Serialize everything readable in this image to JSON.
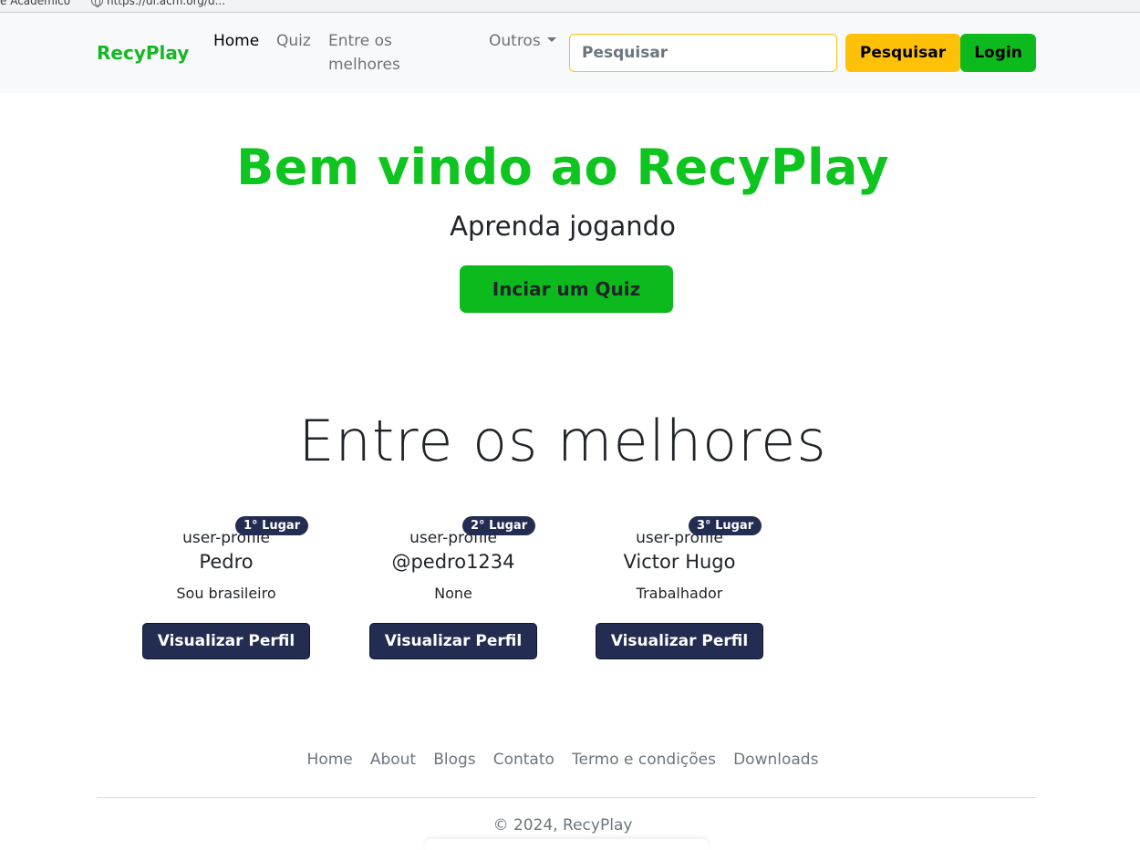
{
  "bookmarks": {
    "item1": "e Acadêmico",
    "item2": "https://dl.acm.org/d..."
  },
  "navbar": {
    "brand": "RecyPlay",
    "links": {
      "home": "Home",
      "quiz": "Quiz",
      "melhores": "Entre os melhores",
      "outros": "Outros"
    },
    "search_placeholder": "Pesquisar",
    "search_button": "Pesquisar",
    "login_button": "Login"
  },
  "hero": {
    "title": "Bem vindo ao RecyPlay",
    "subtitle": "Aprenda jogando",
    "cta": "Inciar um Quiz"
  },
  "ranking": {
    "title": "Entre os melhores",
    "cards": [
      {
        "badge": "1° Lugar",
        "image_alt": "user-profile",
        "name": "Pedro",
        "bio": "Sou brasileiro",
        "button": "Visualizar Perfil"
      },
      {
        "badge": "2° Lugar",
        "image_alt": "user-profile",
        "name": "@pedro1234",
        "bio": "None",
        "button": "Visualizar Perfil"
      },
      {
        "badge": "3° Lugar",
        "image_alt": "user-profile",
        "name": "Victor Hugo",
        "bio": "Trabalhador",
        "button": "Visualizar Perfil"
      }
    ]
  },
  "footer": {
    "links": [
      "Home",
      "About",
      "Blogs",
      "Contato",
      "Termo e condições",
      "Downloads"
    ],
    "copyright": "© 2024, RecyPlay"
  },
  "colors": {
    "brand_green": "#16b725",
    "button_green": "#0dba1d",
    "search_yellow": "#ffc107",
    "badge_navy": "#232d52"
  }
}
